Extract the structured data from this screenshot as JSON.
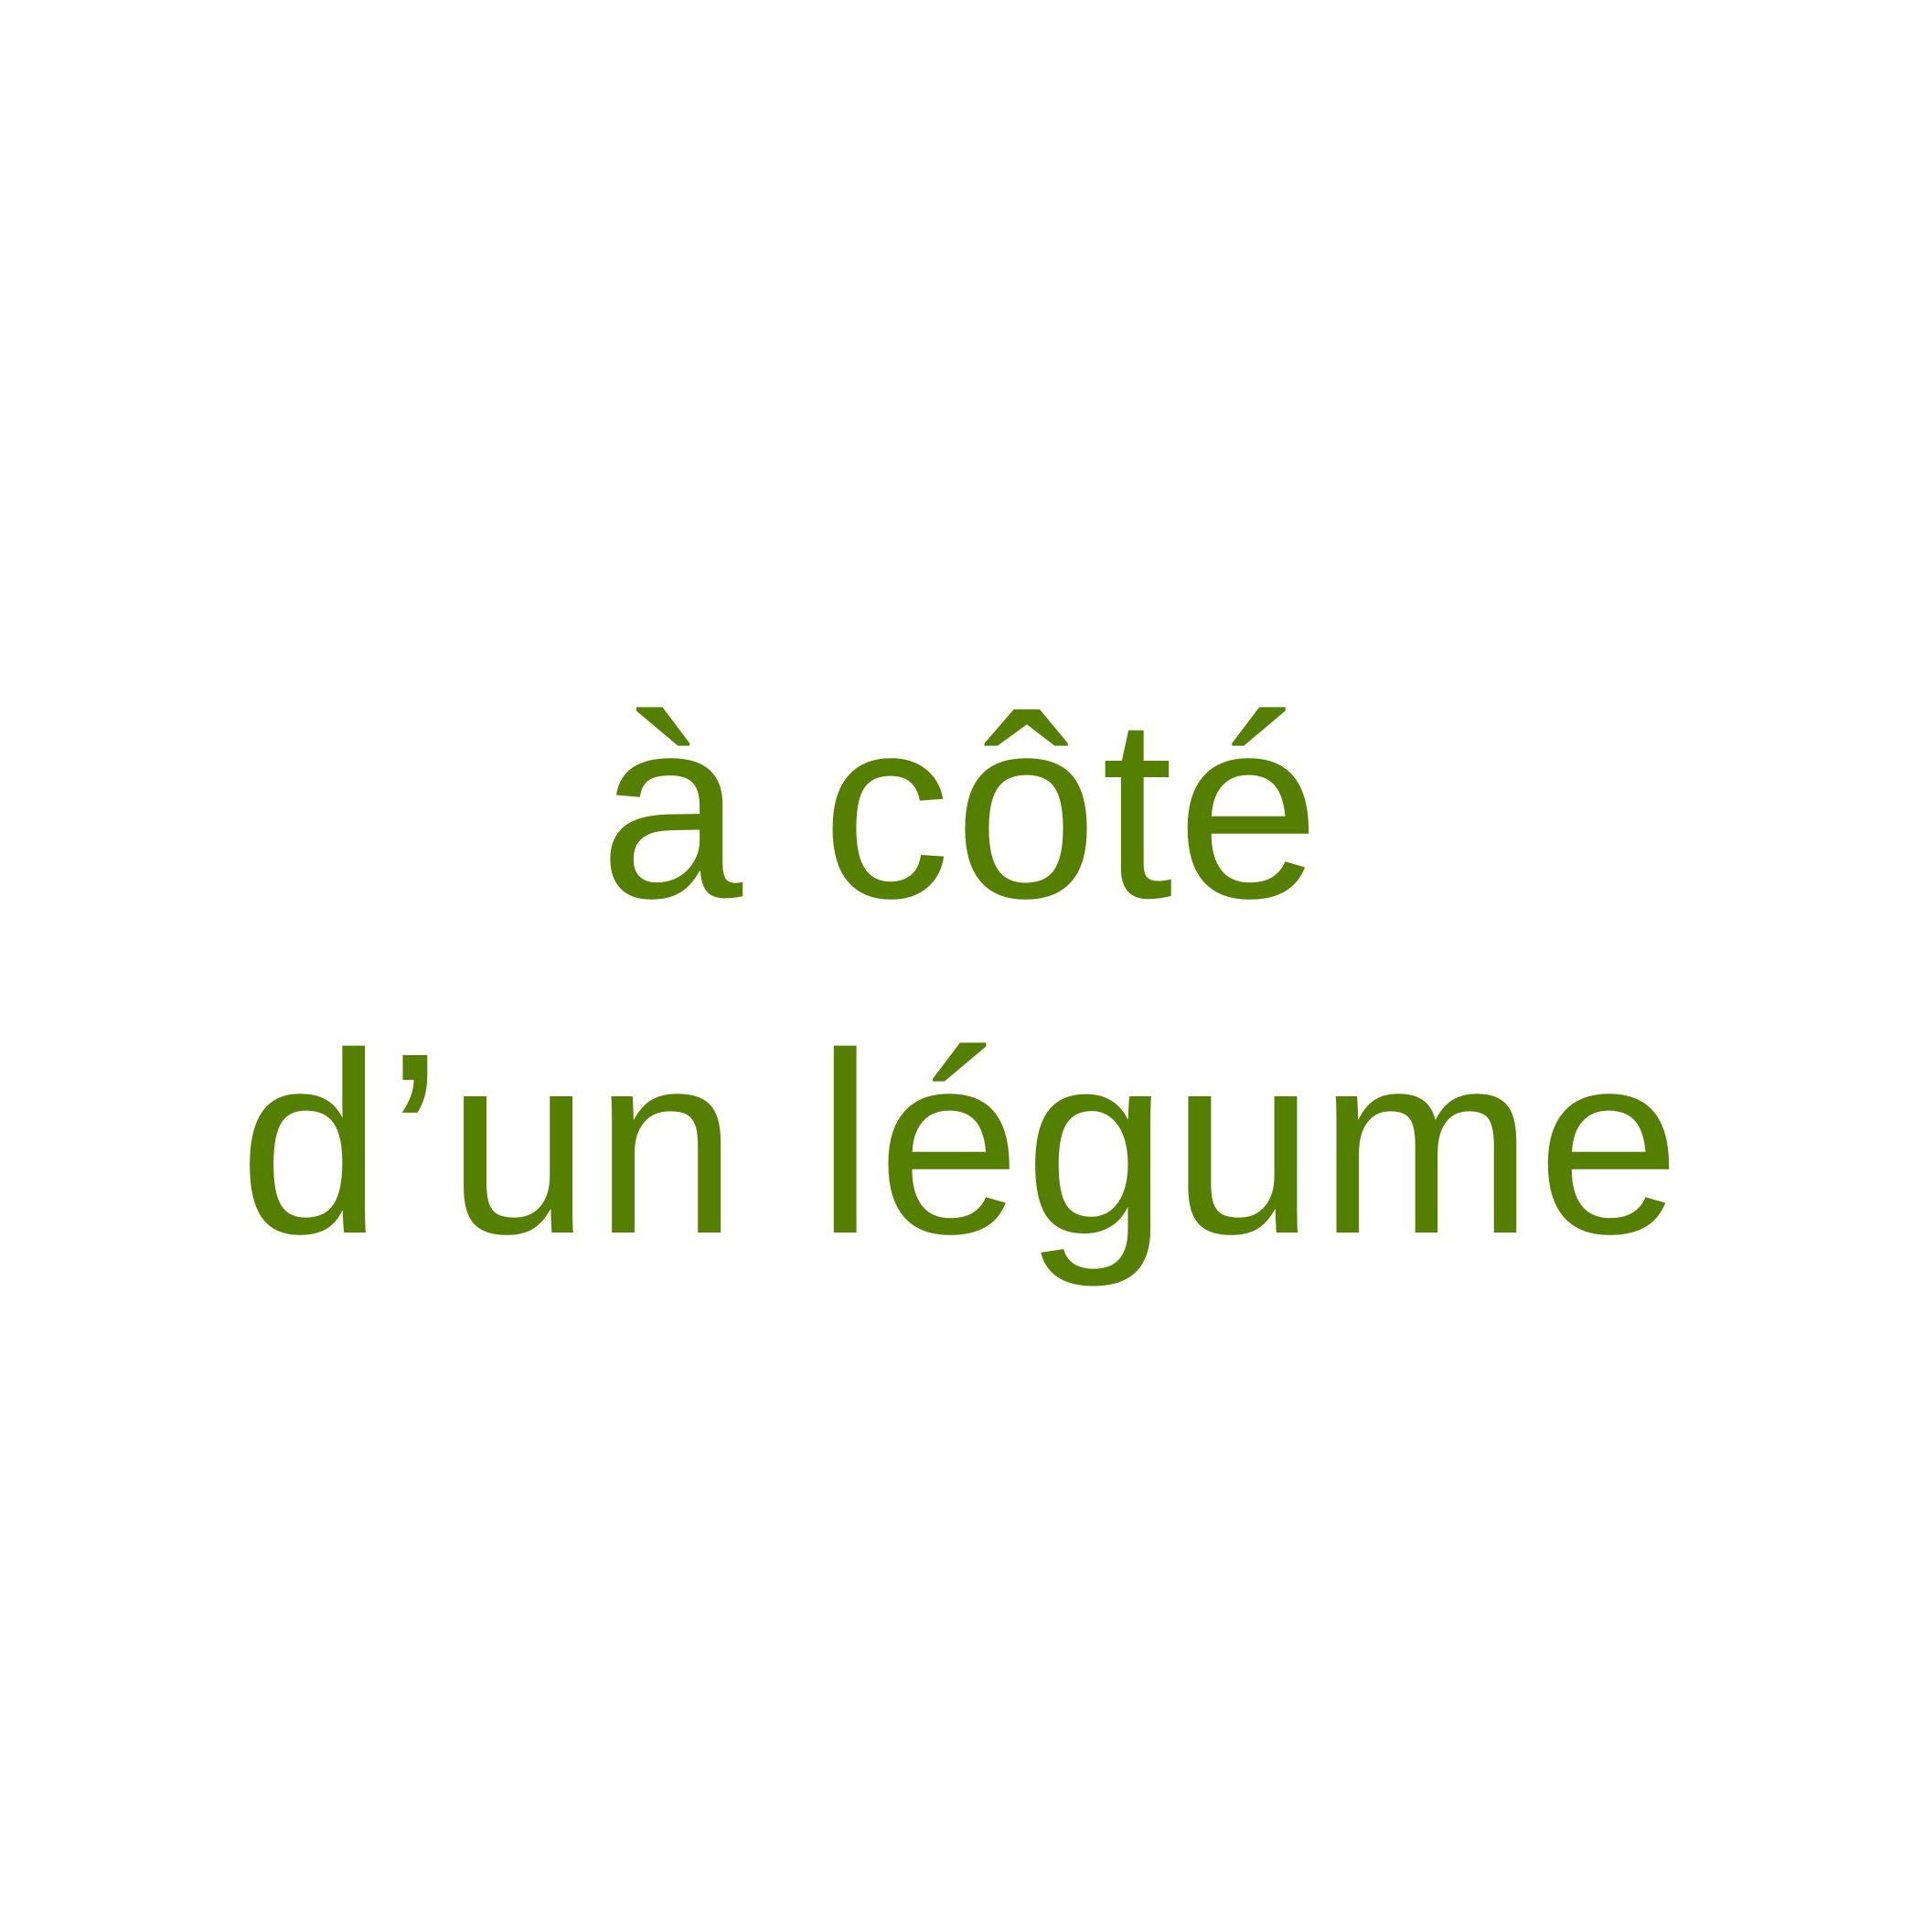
{
  "phrase": {
    "line1": "à côté",
    "line2": "d’un légume"
  },
  "colors": {
    "background": "#ffffff",
    "text": "#557f00"
  }
}
